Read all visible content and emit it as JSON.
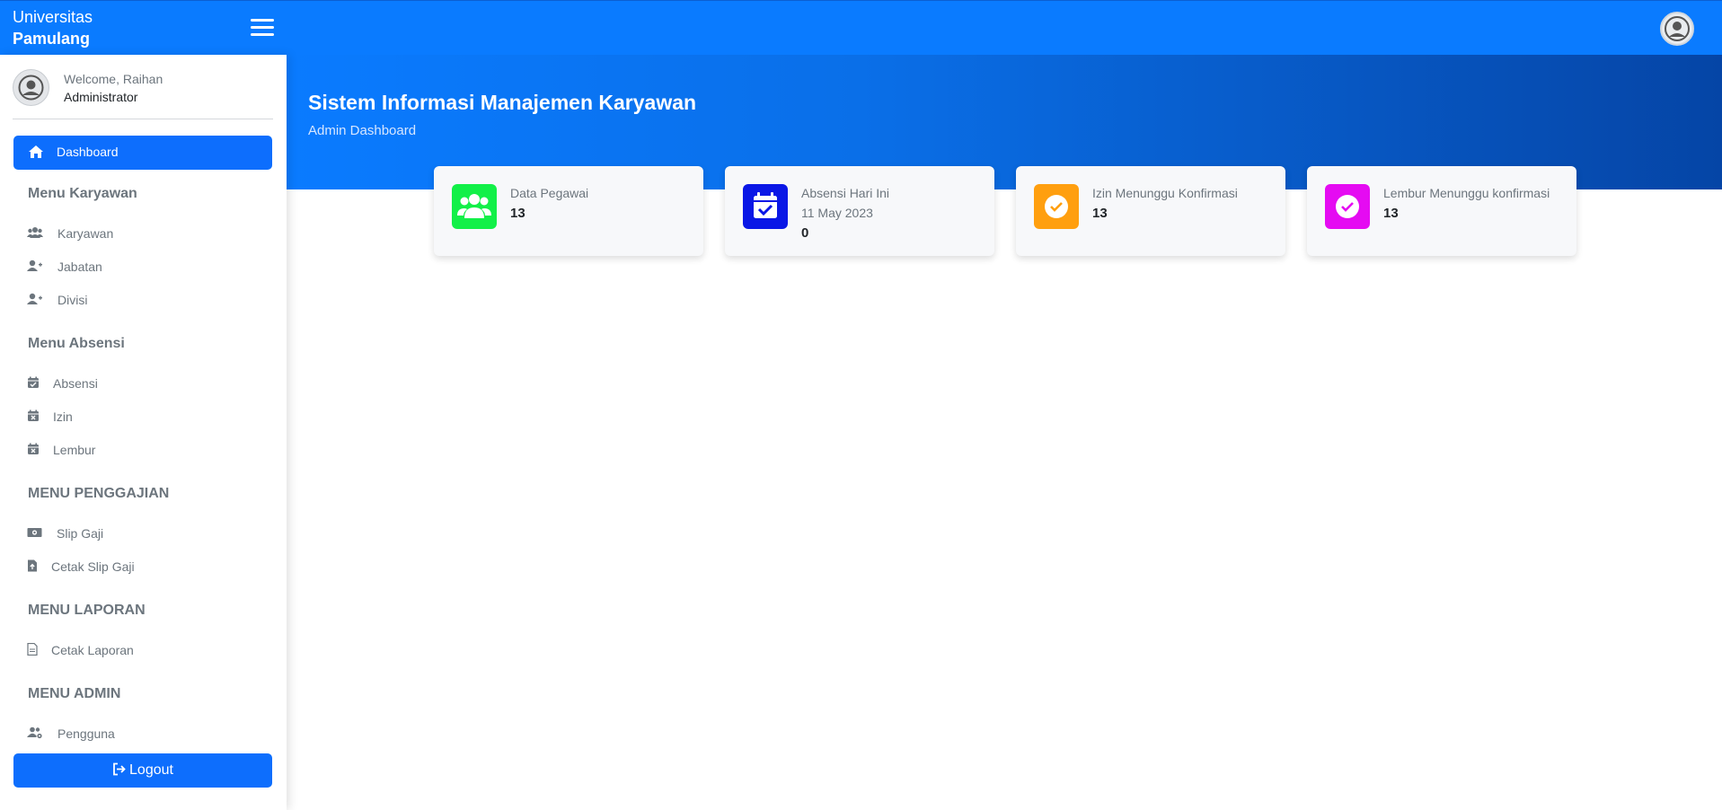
{
  "brand": {
    "line1": "Universitas",
    "line2": "Pamulang"
  },
  "colors": {
    "topbar": "#0a7bff",
    "primary": "#0d6efd",
    "green": "#12f048",
    "blue": "#0a17e6",
    "orange": "#ff9f0f",
    "magenta": "#e50bf2"
  },
  "user": {
    "welcome": "Welcome, Raihan",
    "role": "Administrator"
  },
  "sidebar": {
    "active": {
      "label": "Dashboard",
      "icon": "home-icon"
    },
    "sections": [
      {
        "title": "Menu Karyawan",
        "items": [
          {
            "label": "Karyawan",
            "icon": "users-icon"
          },
          {
            "label": "Jabatan",
            "icon": "user-plus-icon"
          },
          {
            "label": "Divisi",
            "icon": "user-plus-icon"
          }
        ]
      },
      {
        "title": "Menu Absensi",
        "items": [
          {
            "label": "Absensi",
            "icon": "calendar-check-icon"
          },
          {
            "label": "Izin",
            "icon": "calendar-x-icon"
          },
          {
            "label": "Lembur",
            "icon": "calendar-x-icon"
          }
        ]
      },
      {
        "title": "MENU PENGGAJIAN",
        "items": [
          {
            "label": "Slip Gaji",
            "icon": "money-icon"
          },
          {
            "label": "Cetak Slip Gaji",
            "icon": "file-upload-icon"
          }
        ]
      },
      {
        "title": "MENU LAPORAN",
        "items": [
          {
            "label": "Cetak Laporan",
            "icon": "file-icon"
          }
        ]
      },
      {
        "title": "MENU ADMIN",
        "items": [
          {
            "label": "Pengguna",
            "icon": "users-gear-icon"
          }
        ]
      }
    ],
    "logout": "Logout"
  },
  "hero": {
    "title": "Sistem Informasi Manajemen Karyawan",
    "subtitle": "Admin Dashboard"
  },
  "cards": [
    {
      "title": "Data Pegawai",
      "subtitle": "",
      "value": "13",
      "icon": "users-icon",
      "color": "#12f048"
    },
    {
      "title": "Absensi Hari Ini",
      "subtitle": "11 May 2023",
      "value": "0",
      "icon": "calendar-check-icon",
      "color": "#0a17e6"
    },
    {
      "title": "Izin Menunggu Konfirmasi",
      "subtitle": "",
      "value": "13",
      "icon": "check-circle-icon",
      "color": "#ff9f0f"
    },
    {
      "title": "Lembur Menunggu konfirmasi",
      "subtitle": "",
      "value": "13",
      "icon": "check-circle-icon",
      "color": "#e50bf2"
    }
  ]
}
